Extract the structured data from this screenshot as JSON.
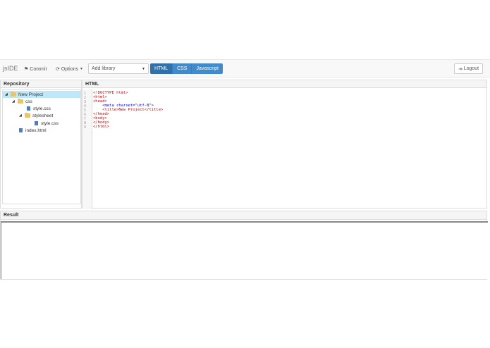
{
  "navbar": {
    "brand": "jsIDE",
    "commit_label": "Commit",
    "options_label": "Options",
    "library_placeholder": "Add library",
    "modes": [
      "HTML",
      "CSS",
      "Javascript"
    ],
    "active_mode": "HTML",
    "logout_label": "Logout"
  },
  "repository": {
    "title": "Repository",
    "tree": [
      {
        "label": "New Project",
        "type": "folder",
        "expanded": true,
        "selected": true
      },
      {
        "label": "css",
        "type": "folder",
        "expanded": true
      },
      {
        "label": "style.css",
        "type": "file"
      },
      {
        "label": "stylesheet",
        "type": "folder",
        "expanded": true
      },
      {
        "label": "style.css",
        "type": "file"
      },
      {
        "label": "index.html",
        "type": "file"
      }
    ]
  },
  "editor": {
    "title": "HTML",
    "line_numbers": [
      "1",
      "2",
      "3",
      "4",
      "5",
      "6",
      "7",
      "8",
      "9"
    ],
    "lines": [
      "<!DOCTYPE html>",
      "<html>",
      "<head>",
      "    <meta charset=\"utf-8\">",
      "    <title>New Project</title>",
      "</head>",
      "<body>",
      "</body>",
      "</html>"
    ]
  },
  "result": {
    "title": "Result"
  }
}
